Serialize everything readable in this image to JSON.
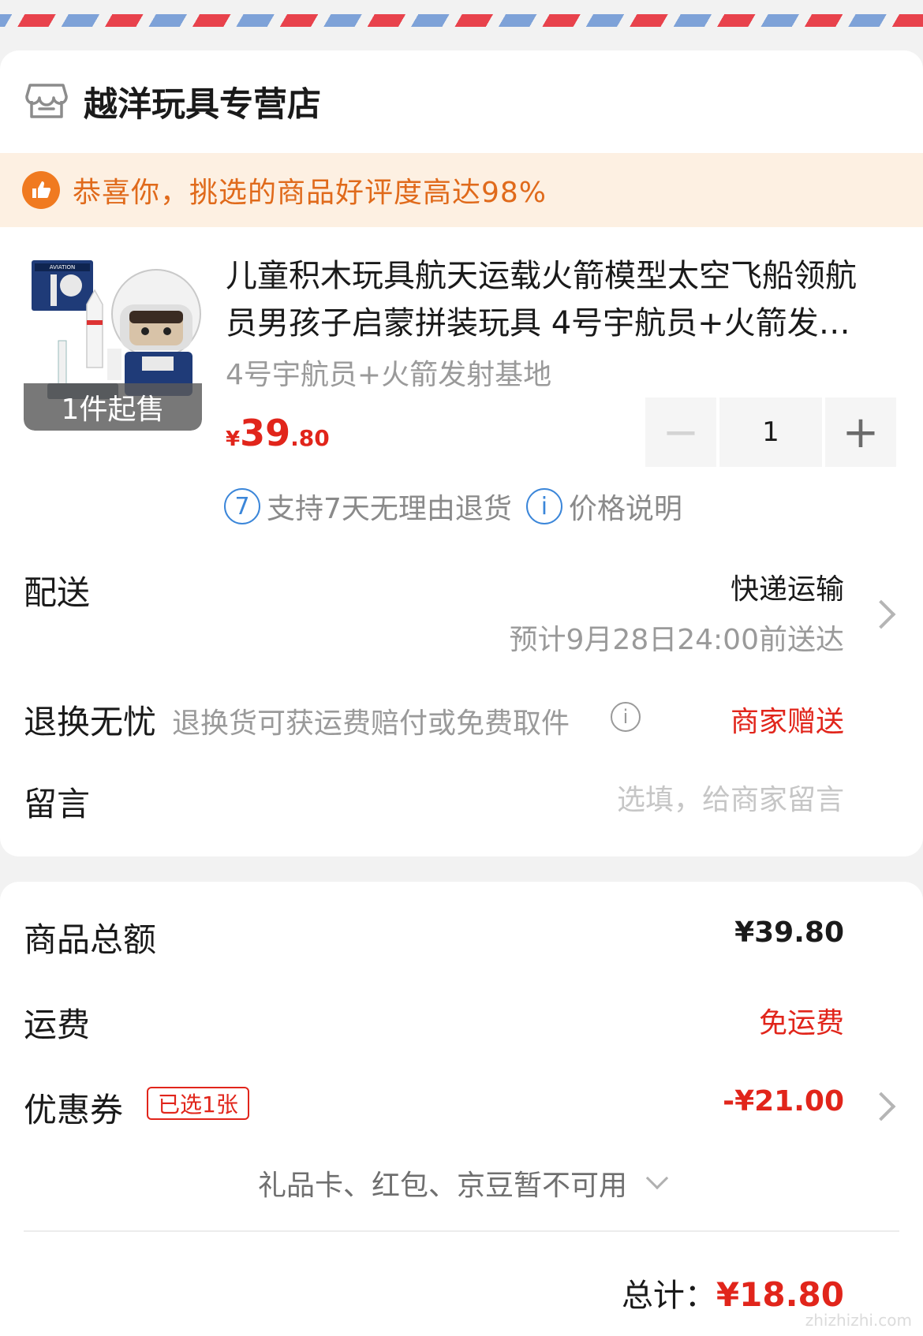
{
  "shop": {
    "name": "越洋玩具专营店"
  },
  "banner": {
    "text": "恭喜你，挑选的商品好评度高达98%"
  },
  "product": {
    "title": "儿童积木玩具航天运载火箭模型太空飞船领航员男孩子启蒙拼装玩具 4号宇航员+火箭发射基地",
    "spec": "4号宇航员+火箭发射基地",
    "min_order": "1件起售",
    "box_label": "AVIATION",
    "price_currency": "¥",
    "price_integer": "39",
    "price_decimal": ".80",
    "quantity": "1",
    "minus": "−",
    "plus": "+"
  },
  "services": {
    "return_icon": "7",
    "return_policy": "支持7天无理由退货",
    "price_icon": "i",
    "price_note": "价格说明"
  },
  "delivery": {
    "label": "配送",
    "method": "快递运输",
    "eta": "预计9月28日24:00前送达"
  },
  "returns": {
    "label": "退换无忧",
    "desc": "退换货可获运费赔付或免费取件",
    "info_icon": "i",
    "value": "商家赠送"
  },
  "message": {
    "label": "留言",
    "placeholder": "选填，给商家留言"
  },
  "summary": {
    "subtotal_label": "商品总额",
    "subtotal_value": "¥39.80",
    "shipping_label": "运费",
    "shipping_value": "免运费",
    "coupon_label": "优惠券",
    "coupon_tag": "已选1张",
    "coupon_value": "-¥21.00",
    "gift_note": "礼品卡、红包、京豆暂不可用",
    "total_label": "总计：",
    "total_value": "¥18.80"
  },
  "watermark": "zhizhizhi.com",
  "colors": {
    "accent_red": "#e1251b",
    "banner_orange": "#e06a1b",
    "banner_bg": "#fdf0e2",
    "info_blue": "#3b86d9"
  },
  "icons": [
    "store-icon",
    "thumbs-up-icon",
    "chevron-right-icon",
    "info-icon",
    "chevron-down-icon"
  ]
}
